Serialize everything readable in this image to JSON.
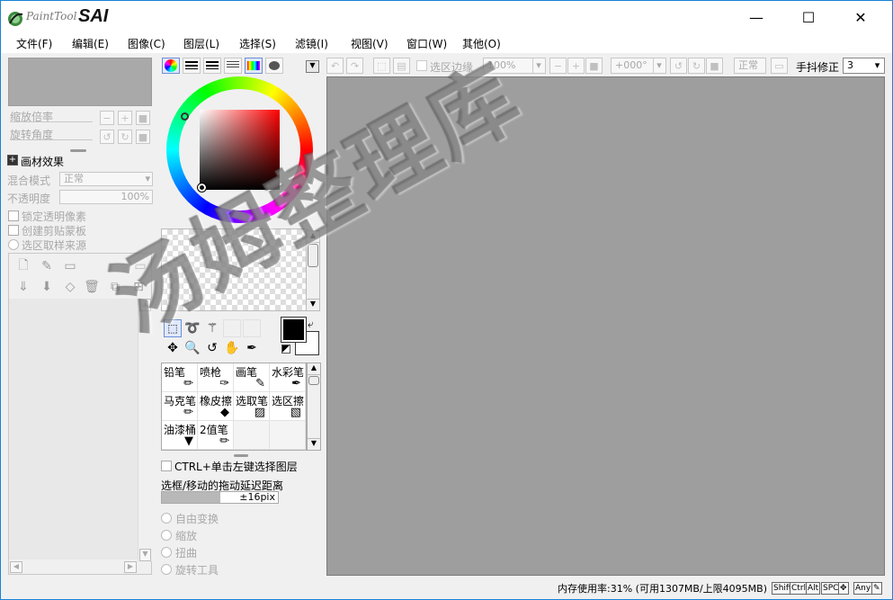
{
  "app": {
    "logo_text": "PaintTool",
    "logo_sai": "SAI"
  },
  "window_controls": {
    "minimize": "—",
    "maximize": "☐",
    "close": "✕"
  },
  "menu": [
    "文件(F)",
    "编辑(E)",
    "图像(C)",
    "图层(L)",
    "选择(S)",
    "滤镜(I)",
    "视图(V)",
    "窗口(W)",
    "其他(O)"
  ],
  "navigator": {
    "zoom_label": "缩放倍率",
    "rotate_label": "旋转角度"
  },
  "layer_panel": {
    "texture_effect": "画材效果",
    "blend_mode_label": "混合模式",
    "blend_mode_value": "正常",
    "opacity_label": "不透明度",
    "opacity_value": "100%",
    "lock_transparency": "锁定透明像素",
    "clipping": "创建剪贴蒙板",
    "selection_source": "选区取样来源"
  },
  "brushes": [
    {
      "label": "铅笔",
      "icon": "✏"
    },
    {
      "label": "喷枪",
      "icon": "✑"
    },
    {
      "label": "画笔",
      "icon": "✎"
    },
    {
      "label": "水彩笔",
      "icon": "✒"
    },
    {
      "label": "马克笔",
      "icon": "✏"
    },
    {
      "label": "橡皮擦",
      "icon": "◆"
    },
    {
      "label": "选取笔",
      "icon": "▨"
    },
    {
      "label": "选区擦",
      "icon": "▧"
    },
    {
      "label": "油漆桶",
      "icon": "▼"
    },
    {
      "label": "2值笔",
      "icon": "✏"
    }
  ],
  "tool_options": {
    "ctrl_select_layer": "CTRL+单击左键选择图层",
    "drag_delay_label": "选框/移动的拖动延迟距离",
    "drag_delay_value": "±16pix",
    "free_transform": "自由变换",
    "scale": "缩放",
    "distort": "扭曲",
    "rotate_tool": "旋转工具"
  },
  "toolbar": {
    "selection_edge": "选区边缘",
    "zoom_value": "100%",
    "angle_value": "+000°",
    "mode_value": "正常",
    "stabilizer_label": "手抖修正",
    "stabilizer_value": "3"
  },
  "watermark": "汤姆整理库",
  "status": {
    "memory": "内存使用率:31% (可用1307MB/上限4095MB)",
    "keys": [
      "Shift",
      "Ctrl",
      "Alt",
      "SPC",
      "✥",
      "Any",
      "✎"
    ]
  },
  "colors": {
    "primary": "#000000",
    "secondary": "#ffffff",
    "canvas_bg": "#9e9e9e",
    "accent_border": "#1883d7"
  }
}
